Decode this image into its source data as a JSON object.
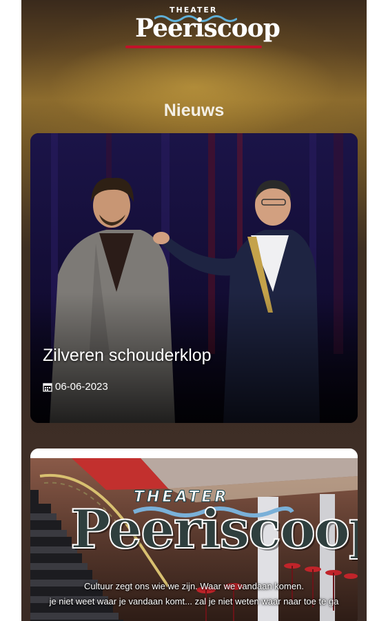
{
  "brand": {
    "theater_label": "THEATER",
    "name": "Peeriscoop"
  },
  "page": {
    "section_title": "Nieuws"
  },
  "news": [
    {
      "title": "Zilveren schouderklop",
      "date": "06-06-2023"
    },
    {
      "image_theater_label": "THEATER",
      "image_name": "Peeriscoop",
      "tagline_1": "Cultuur zegt ons wie we zijn. Waar we vandaan komen.",
      "tagline_2": "je niet weet waar je vandaan komt... zal je niet weten waar naar toe te ga"
    }
  ],
  "colors": {
    "accent_red": "#c2122a",
    "background_brown": "#3b2c24",
    "text_light": "#f3efe6"
  }
}
